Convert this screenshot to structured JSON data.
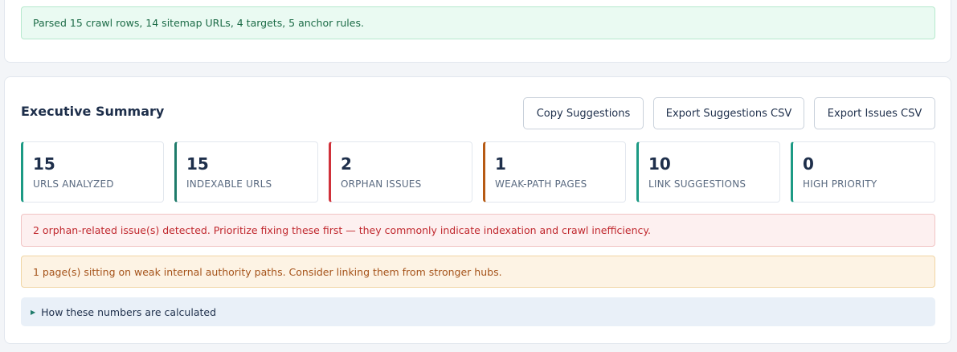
{
  "status": {
    "parsed_message": "Parsed 15 crawl rows, 14 sitemap URLs, 4 targets, 5 anchor rules."
  },
  "summary": {
    "title": "Executive Summary",
    "buttons": {
      "copy_label": "Copy Suggestions",
      "export_suggestions_label": "Export Suggestions CSV",
      "export_issues_label": "Export Issues CSV"
    },
    "stats": [
      {
        "value": "15",
        "label": "URLS ANALYZED",
        "accent": "#1c9a84"
      },
      {
        "value": "15",
        "label": "INDEXABLE URLS",
        "accent": "#1e7b6a"
      },
      {
        "value": "2",
        "label": "ORPHAN ISSUES",
        "accent": "#d0313a"
      },
      {
        "value": "1",
        "label": "WEAK-PATH PAGES",
        "accent": "#b65a14"
      },
      {
        "value": "10",
        "label": "LINK SUGGESTIONS",
        "accent": "#1c9a84"
      },
      {
        "value": "0",
        "label": "HIGH PRIORITY",
        "accent": "#1c9a84"
      }
    ],
    "orphan_alert": "2 orphan-related issue(s) detected. Prioritize fixing these first — they commonly indicate indexation and crawl inefficiency.",
    "weak_path_alert": "1 page(s) sitting on weak internal authority paths. Consider linking them from stronger hubs.",
    "details_toggle": {
      "icon": "triangle-right-icon",
      "label": "How these numbers are calculated"
    }
  },
  "colors": {
    "success_bg": "#eafaf2",
    "danger_text": "#c0272d",
    "warning_text": "#a5531a",
    "heading": "#1e2f4b"
  }
}
